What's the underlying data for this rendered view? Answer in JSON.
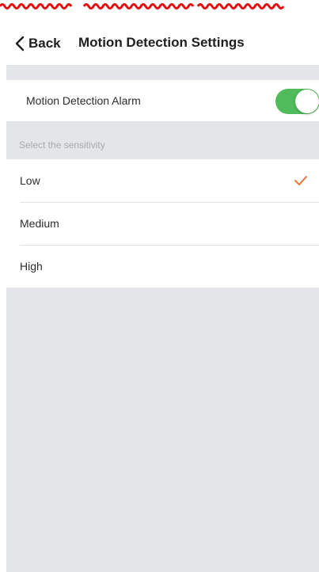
{
  "nav": {
    "back_label": "Back",
    "title": "Motion Detection Settings"
  },
  "alarm": {
    "label": "Motion Detection Alarm",
    "enabled": true
  },
  "sensitivity": {
    "section_label": "Select the sensitivity",
    "options": [
      {
        "label": "Low",
        "selected": true
      },
      {
        "label": "Medium",
        "selected": false
      },
      {
        "label": "High",
        "selected": false
      }
    ]
  },
  "icons": {
    "back": "chevron-left-icon",
    "selected": "checkmark-icon"
  },
  "colors": {
    "toggle_on": "#4fbb5a",
    "checkmark": "#e8773e",
    "section_background": "#e4e5e9",
    "status_scribble": "#e20e12"
  }
}
